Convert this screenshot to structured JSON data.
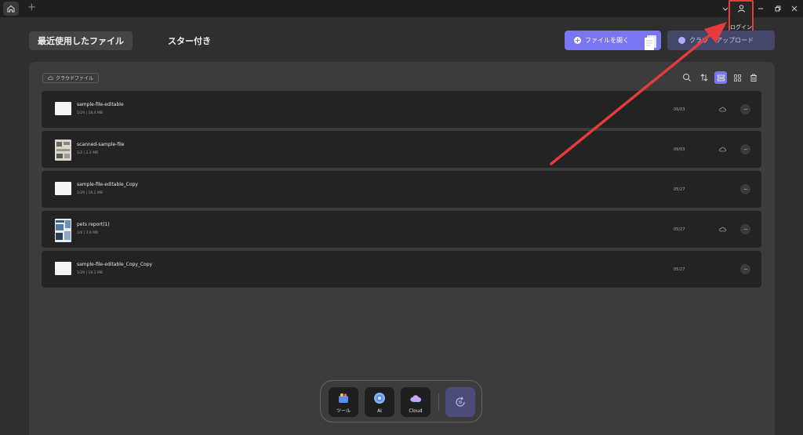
{
  "titlebar": {
    "new_tab": "+"
  },
  "header": {
    "login_label": "ログイン",
    "tabs": [
      {
        "label": "最近使用したファイル",
        "active": true
      },
      {
        "label": "スター付き",
        "active": false
      }
    ],
    "open_file_label": "ファイルを開く",
    "upload_label": "クラウドへアップロード",
    "upload_label_visible": "クラウ    アップロード"
  },
  "panel": {
    "cloud_tag": "クラウドファイル",
    "toolbar_icons": [
      "search-icon",
      "sort-icon",
      "list-view-icon",
      "grid-view-icon",
      "delete-icon"
    ]
  },
  "files": [
    {
      "name": "sample-file-editable",
      "meta": "1/29 | 18.4 MB",
      "date": "06/03",
      "cloud": true,
      "thumb": "doc"
    },
    {
      "name": "scanned-sample-file",
      "meta": "1/2 | 2.2 MB",
      "date": "06/03",
      "cloud": true,
      "thumb": "scan"
    },
    {
      "name": "sample-file-editable_Copy",
      "meta": "1/29 | 18.2 MB",
      "date": "05/27",
      "cloud": false,
      "thumb": "doc"
    },
    {
      "name": "pets report(1)",
      "meta": "1/6 | 3.8 MB",
      "date": "05/27",
      "cloud": true,
      "thumb": "pets"
    },
    {
      "name": "sample-file-editable_Copy_Copy",
      "meta": "1/29 | 18.3 MB",
      "date": "05/27",
      "cloud": false,
      "thumb": "doc"
    }
  ],
  "dock": {
    "items": [
      {
        "label": "ツール",
        "icon": "tools-icon"
      },
      {
        "label": "AI",
        "icon": "ai-icon"
      },
      {
        "label": "Cloud",
        "icon": "cloud-icon"
      }
    ],
    "sync_icon": "sync-icon"
  },
  "colors": {
    "accent": "#7a76f2",
    "annotation": "#e63b3b",
    "background": "#2f2f2f",
    "row": "#232323"
  }
}
